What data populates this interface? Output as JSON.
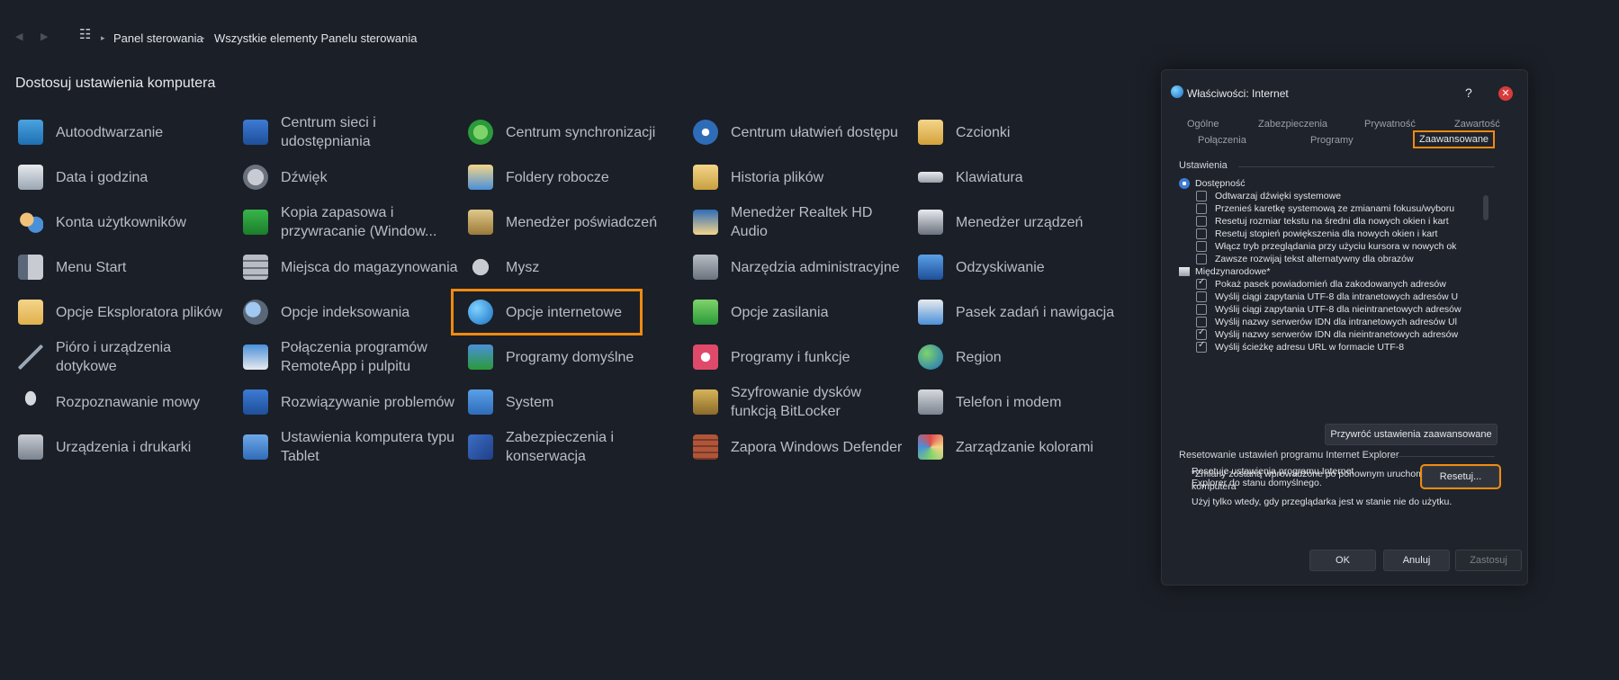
{
  "breadcrumb": {
    "items": [
      "Panel sterowania",
      "Wszystkie elementy Panelu sterowania"
    ]
  },
  "page_title": "Dostosuj ustawienia komputera",
  "columns": [
    [
      {
        "label": "Autoodtwarzanie",
        "icon": "autoplay-icon"
      },
      {
        "label": "Data i godzina",
        "icon": "calendar-clock-icon"
      },
      {
        "label": "Konta użytkowników",
        "icon": "users-icon"
      },
      {
        "label": "Menu Start",
        "icon": "start-menu-icon"
      },
      {
        "label": "Opcje Eksploratora plików",
        "icon": "folder-options-icon"
      },
      {
        "label": "Pióro i urządzenia dotykowe",
        "icon": "pen-icon"
      },
      {
        "label": "Rozpoznawanie mowy",
        "icon": "microphone-icon"
      },
      {
        "label": "Urządzenia i drukarki",
        "icon": "printer-icon"
      }
    ],
    [
      {
        "label": "Centrum sieci i udostępniania",
        "icon": "network-icon"
      },
      {
        "label": "Dźwięk",
        "icon": "speaker-icon"
      },
      {
        "label": "Kopia zapasowa i przywracanie (Window...",
        "icon": "backup-icon"
      },
      {
        "label": "Miejsca do magazynowania",
        "icon": "storage-icon"
      },
      {
        "label": "Opcje indeksowania",
        "icon": "indexing-icon"
      },
      {
        "label": "Połączenia programów RemoteApp i pulpitu",
        "icon": "remoteapp-icon"
      },
      {
        "label": "Rozwiązywanie problemów",
        "icon": "troubleshoot-icon"
      },
      {
        "label": "Ustawienia komputera typu Tablet",
        "icon": "tablet-icon"
      }
    ],
    [
      {
        "label": "Centrum synchronizacji",
        "icon": "sync-icon"
      },
      {
        "label": "Foldery robocze",
        "icon": "work-folders-icon"
      },
      {
        "label": "Menedżer poświadczeń",
        "icon": "credential-vault-icon"
      },
      {
        "label": "Mysz",
        "icon": "mouse-icon"
      },
      {
        "label": "Opcje internetowe",
        "icon": "internet-options-icon"
      },
      {
        "label": "Programy domyślne",
        "icon": "default-programs-icon"
      },
      {
        "label": "System",
        "icon": "system-icon"
      },
      {
        "label": "Zabezpieczenia i konserwacja",
        "icon": "flag-icon"
      }
    ],
    [
      {
        "label": "Centrum ułatwień dostępu",
        "icon": "ease-of-access-icon"
      },
      {
        "label": "Historia plików",
        "icon": "file-history-icon"
      },
      {
        "label": "Menedżer Realtek HD Audio",
        "icon": "realtek-audio-icon"
      },
      {
        "label": "Narzędzia administracyjne",
        "icon": "admin-tools-icon"
      },
      {
        "label": "Opcje zasilania",
        "icon": "power-icon"
      },
      {
        "label": "Programy i funkcje",
        "icon": "programs-features-icon"
      },
      {
        "label": "Szyfrowanie dysków funkcją BitLocker",
        "icon": "bitlocker-icon"
      },
      {
        "label": "Zapora Windows Defender",
        "icon": "firewall-icon"
      }
    ],
    [
      {
        "label": "Czcionki",
        "icon": "fonts-icon"
      },
      {
        "label": "Klawiatura",
        "icon": "keyboard-icon"
      },
      {
        "label": "Menedżer urządzeń",
        "icon": "device-manager-icon"
      },
      {
        "label": "Odzyskiwanie",
        "icon": "recovery-icon"
      },
      {
        "label": "Pasek zadań i nawigacja",
        "icon": "taskbar-icon"
      },
      {
        "label": "Region",
        "icon": "region-icon"
      },
      {
        "label": "Telefon i modem",
        "icon": "phone-icon"
      },
      {
        "label": "Zarządzanie kolorami",
        "icon": "color-management-icon"
      }
    ]
  ],
  "selected_item": "Opcje internetowe",
  "dialog": {
    "title": "Właściwości: Internet",
    "help": "?",
    "tabs_row1": [
      "Ogólne",
      "Zabezpieczenia",
      "Prywatność",
      "Zawartość"
    ],
    "tabs_row2": [
      "Połączenia",
      "Programy",
      "Zaawansowane"
    ],
    "settings_label": "Ustawienia",
    "groups": [
      {
        "name": "Dostępność",
        "items": [
          {
            "label": "Odtwarzaj dźwięki systemowe",
            "checked": false
          },
          {
            "label": "Przenieś karetkę systemową ze zmianami fokusu/wyboru",
            "checked": false
          },
          {
            "label": "Resetuj rozmiar tekstu na średni dla nowych okien i kart",
            "checked": false
          },
          {
            "label": "Resetuj stopień powiększenia dla nowych okien i kart",
            "checked": false
          },
          {
            "label": "Włącz tryb przeglądania przy użyciu kursora w nowych ok",
            "checked": false
          },
          {
            "label": "Zawsze rozwijaj tekst alternatywny dla obrazów",
            "checked": false
          }
        ]
      },
      {
        "name": "Międzynarodowe*",
        "items": [
          {
            "label": "Pokaż pasek powiadomień dla zakodowanych adresów",
            "checked": true
          },
          {
            "label": "Wyślij ciągi zapytania UTF-8 dla intranetowych adresów U",
            "checked": false
          },
          {
            "label": "Wyślij ciągi zapytania UTF-8 dla nieintranetowych adresów",
            "checked": false
          },
          {
            "label": "Wyślij nazwy serwerów IDN dla intranetowych adresów Ul",
            "checked": false
          },
          {
            "label": "Wyślij nazwy serwerów IDN dla nieintranetowych adresów",
            "checked": true
          },
          {
            "label": "Wyślij ścieżkę adresu URL w formacie UTF-8",
            "checked": true
          }
        ]
      }
    ],
    "note": "*Zmiany zostaną wprowadzone po ponownym uruchomieniu komputera",
    "restore_button": "Przywróć ustawienia zaawansowane",
    "reset_section_label": "Resetowanie ustawień programu Internet Explorer",
    "reset_desc": "Resetuje ustawienia programu Internet Explorer do stanu domyślnego.",
    "reset_button": "Resetuj...",
    "reset_warning": "Użyj tylko wtedy, gdy przeglądarka jest w stanie nie do użytku.",
    "ok_button": "OK",
    "cancel_button": "Anuluj",
    "apply_button": "Zastosuj"
  },
  "colors": {
    "background": "#1b1f27",
    "highlight": "#f08a10",
    "close": "#d83b3b"
  }
}
